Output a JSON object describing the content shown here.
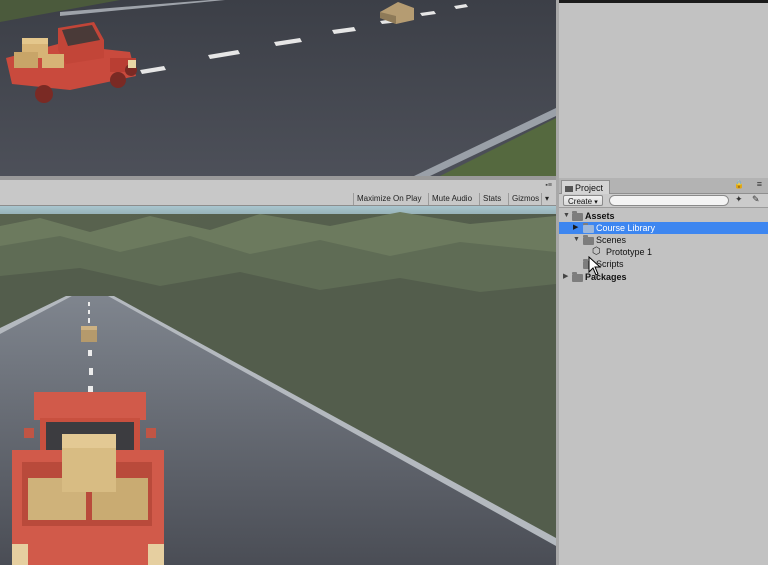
{
  "game_toolbar": {
    "maximize_on_play": "Maximize On Play",
    "mute_audio": "Mute Audio",
    "stats": "Stats",
    "gizmos": "Gizmos",
    "gizmos_arrow": "▾"
  },
  "project": {
    "tab_label": "Project",
    "create_label": "Create",
    "create_arrow": "▾",
    "search_value": "",
    "tree": [
      {
        "label": "Assets",
        "expanded": true,
        "bold": true
      },
      {
        "label": "Course Library",
        "selected": true
      },
      {
        "label": "Scenes",
        "expanded": true
      },
      {
        "label": "Prototype 1"
      },
      {
        "label": "Scripts"
      },
      {
        "label": "Packages",
        "bold": true
      }
    ]
  },
  "colors": {
    "selection": "#3d86f0",
    "truck_body": "#d15a4a",
    "crate": "#cfb27a",
    "panel_bg": "#c2c2c2"
  }
}
